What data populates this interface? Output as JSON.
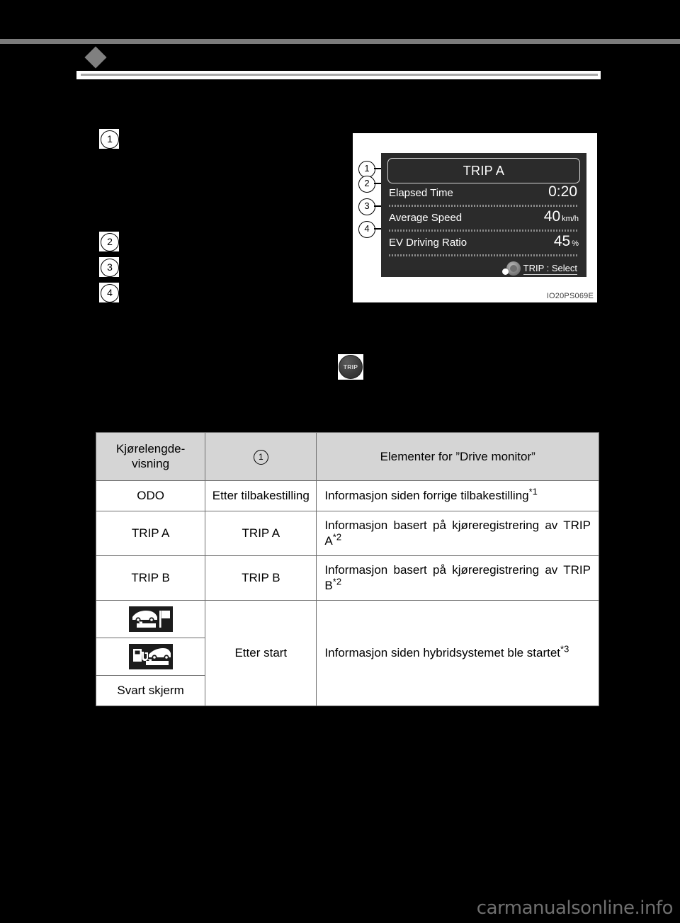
{
  "page": {
    "watermark": "carmanualsonline.info"
  },
  "figure": {
    "image_code": "IO20PS069E",
    "meter": {
      "title": "TRIP A",
      "rows": [
        {
          "label": "Elapsed Time",
          "value": "0:20",
          "unit": ""
        },
        {
          "label": "Average Speed",
          "value": "40",
          "unit": "km/h"
        },
        {
          "label": "EV Driving Ratio",
          "value": "45",
          "unit": "%"
        }
      ],
      "footer": "TRIP : Select"
    },
    "callouts": [
      "1",
      "2",
      "3",
      "4"
    ]
  },
  "callouts": {
    "one": "1",
    "two": "2",
    "three": "3",
    "four": "4"
  },
  "trip_button": {
    "label": "TRIP"
  },
  "table": {
    "headers": {
      "col1": "Kjørelengde-visning",
      "col2": "1",
      "col3": "Elementer for ”Drive monitor”"
    },
    "rows": [
      {
        "col1": "ODO",
        "col2": "Etter tilbakestilling",
        "col3": "Informasjon siden forrige tilbakestilling",
        "footnote": "*1"
      },
      {
        "col1": "TRIP A",
        "col2": "TRIP A",
        "col3": "Informasjon basert på kjøreregistrering av TRIP A",
        "footnote": "*2"
      },
      {
        "col1": "TRIP B",
        "col2": "TRIP B",
        "col3": "Informasjon basert på kjøreregistrering av TRIP B",
        "footnote": "*2"
      },
      {
        "col1_icon": "car-destination-flag-icon",
        "col2": "Etter start",
        "col3": "Informasjon siden hybridsystemet ble startet",
        "footnote": "*3"
      },
      {
        "col1_icon": "car-fuel-pump-icon"
      },
      {
        "col1": "Svart skjerm"
      }
    ]
  }
}
